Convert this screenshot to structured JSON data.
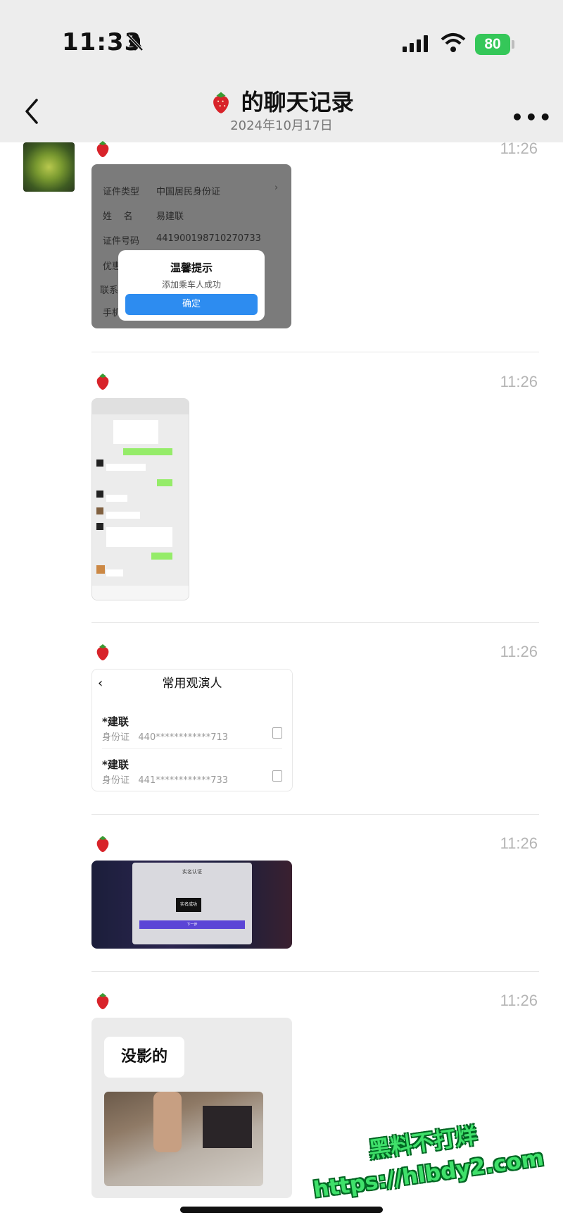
{
  "status_bar": {
    "time": "11:33",
    "battery": "80"
  },
  "nav": {
    "title": "的聊天记录",
    "date": "2024年10月17日"
  },
  "messages": [
    {
      "time": "11:26"
    },
    {
      "time": "11:26"
    },
    {
      "time": "11:26"
    },
    {
      "time": "11:26"
    },
    {
      "time": "11:26"
    }
  ],
  "msg1": {
    "row1_label": "证件类型",
    "row1_value": "中国居民身份证",
    "row2_label": "姓    名",
    "row2_value": "易建联",
    "row3_label": "证件号码",
    "row3_value": "441900198710270733",
    "row4_label": "优惠",
    "row5_label": "联系人",
    "row6_label": "手机",
    "dialog_title": "温馨提示",
    "dialog_text": "添加乘车人成功",
    "dialog_button": "确定"
  },
  "msg3": {
    "header": "常用观演人",
    "people": [
      {
        "name": "*建联",
        "id": "身份证   440************713"
      },
      {
        "name": "*建联",
        "id": "身份证   441************733"
      }
    ]
  },
  "msg4": {
    "title": "实名认证",
    "toast": "实名成功",
    "button": "下一步"
  },
  "msg5": {
    "bubble": "没影的"
  },
  "watermark": {
    "line1": "黑料不打烊",
    "line2": "https://hlbdy2.com"
  }
}
